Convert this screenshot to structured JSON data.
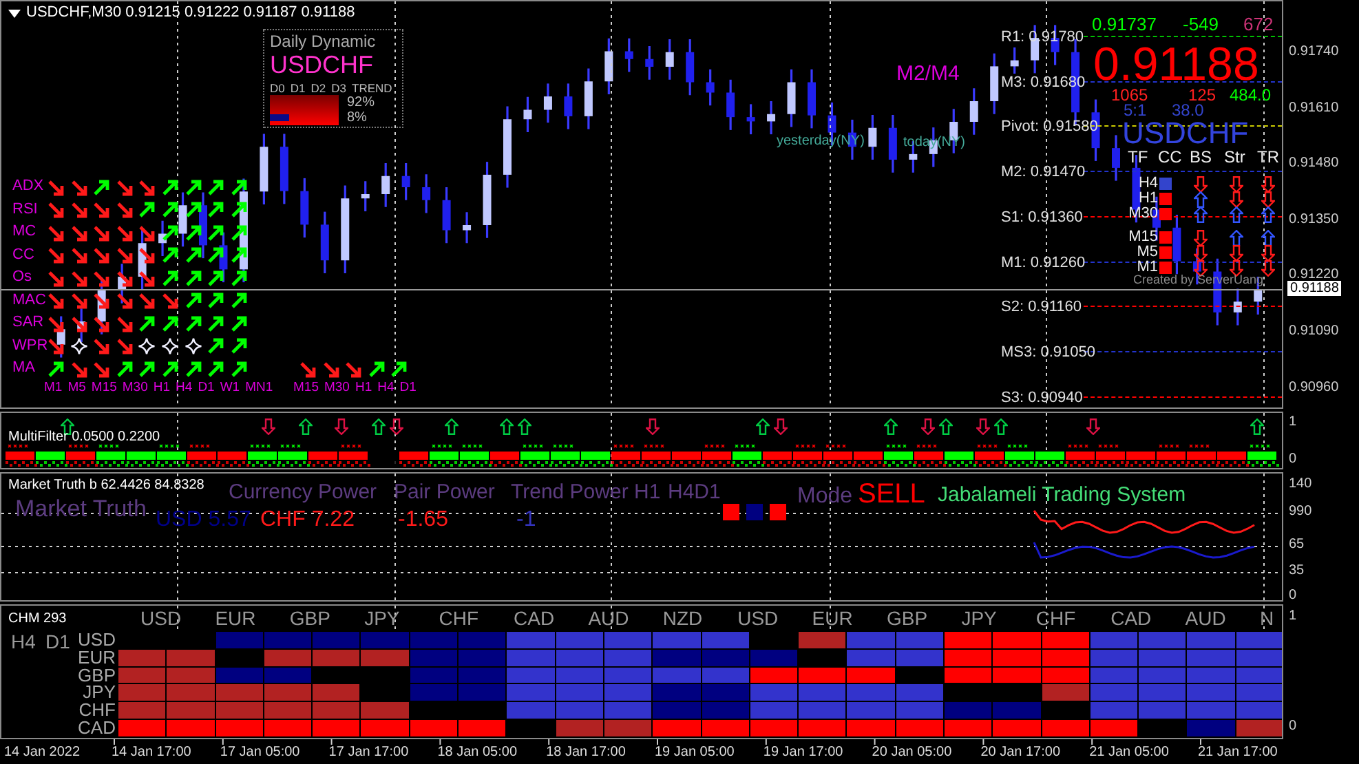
{
  "header": {
    "symbol_line": "USDCHF,M30  0.91215 0.91222 0.91187 0.91188"
  },
  "price_chart": {
    "chart_data": {
      "type": "candlestick",
      "categories": [
        null,
        null,
        null,
        null,
        null,
        null,
        null,
        null,
        null,
        null,
        null,
        null,
        null,
        null,
        null,
        null,
        null,
        null,
        null,
        null,
        null,
        null,
        null,
        null,
        null,
        null,
        null,
        null,
        null,
        null,
        null,
        null,
        null,
        null,
        null,
        null,
        null,
        null,
        null,
        null,
        null,
        null,
        null,
        null,
        null,
        null,
        null,
        null,
        null,
        null,
        null,
        null,
        null,
        null,
        null,
        null,
        null,
        null,
        null,
        null
      ],
      "ohlc": [
        [
          0.9106,
          0.91126,
          0.9103,
          0.91096
        ],
        [
          0.91096,
          0.91144,
          0.91066,
          0.91114
        ],
        [
          0.91114,
          0.91216,
          0.91084,
          0.91186
        ],
        [
          0.91186,
          0.91248,
          0.91156,
          0.91218
        ],
        [
          0.91218,
          0.91326,
          0.91188,
          0.91296
        ],
        [
          0.91296,
          0.91348,
          0.91266,
          0.91318
        ],
        [
          0.91318,
          0.91414,
          0.91288,
          0.91384
        ],
        [
          0.91384,
          0.91414,
          0.91261,
          0.91291
        ],
        [
          0.91291,
          0.91321,
          0.91205,
          0.91235
        ],
        [
          0.91235,
          0.91446,
          0.91205,
          0.91416
        ],
        [
          0.91416,
          0.9155,
          0.91386,
          0.9152
        ],
        [
          0.9152,
          0.9155,
          0.91387,
          0.91417
        ],
        [
          0.91417,
          0.91447,
          0.91309,
          0.91339
        ],
        [
          0.91339,
          0.91369,
          0.91226,
          0.91256
        ],
        [
          0.91256,
          0.9143,
          0.91226,
          0.914
        ],
        [
          0.914,
          0.9144,
          0.9137,
          0.9141
        ],
        [
          0.9141,
          0.91482,
          0.9138,
          0.91452
        ],
        [
          0.91452,
          0.91482,
          0.91396,
          0.91426
        ],
        [
          0.91426,
          0.91456,
          0.91366,
          0.91396
        ],
        [
          0.91396,
          0.91426,
          0.91296,
          0.91326
        ],
        [
          0.91326,
          0.91368,
          0.91296,
          0.91338
        ],
        [
          0.91338,
          0.91485,
          0.91308,
          0.91455
        ],
        [
          0.91455,
          0.91614,
          0.91425,
          0.91584
        ],
        [
          0.91584,
          0.91636,
          0.91554,
          0.91606
        ],
        [
          0.91606,
          0.91667,
          0.91576,
          0.91637
        ],
        [
          0.91637,
          0.91667,
          0.91561,
          0.91591
        ],
        [
          0.91591,
          0.91702,
          0.91561,
          0.91672
        ],
        [
          0.91672,
          0.91772,
          0.91642,
          0.91742
        ],
        [
          0.91742,
          0.91772,
          0.91694,
          0.91724
        ],
        [
          0.91724,
          0.91754,
          0.91676,
          0.91706
        ],
        [
          0.91706,
          0.9177,
          0.91676,
          0.9174
        ],
        [
          0.9174,
          0.9177,
          0.9164,
          0.9167
        ],
        [
          0.9167,
          0.917,
          0.91616,
          0.91646
        ],
        [
          0.91646,
          0.91676,
          0.91559,
          0.91589
        ],
        [
          0.91589,
          0.91619,
          0.91549,
          0.91579
        ],
        [
          0.91579,
          0.91626,
          0.91549,
          0.91596
        ],
        [
          0.91596,
          0.917,
          0.91566,
          0.9167
        ],
        [
          0.9167,
          0.917,
          0.91563,
          0.91593
        ],
        [
          0.91593,
          0.91623,
          0.91523,
          0.91553
        ],
        [
          0.91553,
          0.91583,
          0.9149,
          0.9152
        ],
        [
          0.9152,
          0.91594,
          0.9149,
          0.91564
        ],
        [
          0.91564,
          0.91594,
          0.9146,
          0.9149
        ],
        [
          0.9149,
          0.91533,
          0.9146,
          0.91503
        ],
        [
          0.91503,
          0.91565,
          0.91473,
          0.91535
        ],
        [
          0.91535,
          0.91608,
          0.91505,
          0.91578
        ],
        [
          0.91578,
          0.91656,
          0.91548,
          0.91626
        ],
        [
          0.91626,
          0.91737,
          0.91596,
          0.91707
        ],
        [
          0.91707,
          0.91751,
          0.9169,
          0.91721
        ],
        [
          0.91721,
          0.91803,
          0.91691,
          0.91773
        ],
        [
          0.91773,
          0.91803,
          0.9171,
          0.9174
        ],
        [
          0.9174,
          0.9177,
          0.9157,
          0.916
        ],
        [
          0.916,
          0.9163,
          0.91487,
          0.91517
        ],
        [
          0.91517,
          0.91547,
          0.91441,
          0.91471
        ],
        [
          0.91471,
          0.91501,
          0.91344,
          0.91374
        ],
        [
          0.91374,
          0.91404,
          0.91302,
          0.91332
        ],
        [
          0.91332,
          0.91362,
          0.91224,
          0.91254
        ],
        [
          0.91254,
          0.91284,
          0.912,
          0.9123
        ],
        [
          0.9123,
          0.9126,
          0.91105,
          0.91135
        ],
        [
          0.91135,
          0.9119,
          0.91105,
          0.9116
        ],
        [
          0.9116,
          0.91218,
          0.9113,
          0.91188
        ]
      ],
      "ylim": [
        0.90914,
        0.91858
      ],
      "yticks": [
        {
          "value": 0.9174,
          "label": "0.91740"
        },
        {
          "value": 0.9161,
          "label": "0.91610"
        },
        {
          "value": 0.9148,
          "label": "0.91480"
        },
        {
          "value": 0.9135,
          "label": "0.91350"
        },
        {
          "value": 0.9122,
          "label": "0.91220"
        },
        {
          "value": 0.9109,
          "label": "0.91090"
        },
        {
          "value": 0.9096,
          "label": "0.90960"
        }
      ]
    },
    "current_price": "0.91188"
  },
  "signal_matrix": {
    "rows": [
      {
        "label": "ADX",
        "cells": [
          {
            "kind": "down"
          },
          {
            "kind": "down"
          },
          {
            "kind": "up"
          },
          {
            "kind": "down"
          },
          {
            "kind": "down"
          },
          {
            "kind": "up"
          },
          {
            "kind": "up"
          },
          {
            "kind": "up"
          },
          {
            "kind": "up"
          }
        ]
      },
      {
        "label": "RSI",
        "cells": [
          {
            "kind": "down"
          },
          {
            "kind": "down"
          },
          {
            "kind": "down"
          },
          {
            "kind": "down"
          },
          {
            "kind": "up"
          },
          {
            "kind": "up"
          },
          {
            "kind": "up"
          },
          {
            "kind": "up"
          },
          {
            "kind": "up"
          }
        ]
      },
      {
        "label": "MC",
        "cells": [
          {
            "kind": "down"
          },
          {
            "kind": "down"
          },
          {
            "kind": "down"
          },
          {
            "kind": "down"
          },
          {
            "kind": "down"
          },
          {
            "kind": "up"
          },
          {
            "kind": "up"
          },
          {
            "kind": "up"
          },
          {
            "kind": "up"
          }
        ]
      },
      {
        "label": "CC",
        "cells": [
          {
            "kind": "down"
          },
          {
            "kind": "down"
          },
          {
            "kind": "down"
          },
          {
            "kind": "down"
          },
          {
            "kind": "down"
          },
          {
            "kind": "up"
          },
          {
            "kind": "up"
          },
          {
            "kind": "up"
          },
          {
            "kind": "up"
          }
        ]
      },
      {
        "label": "Os",
        "cells": [
          {
            "kind": "down"
          },
          {
            "kind": "down"
          },
          {
            "kind": "down"
          },
          {
            "kind": "down"
          },
          {
            "kind": "down"
          },
          {
            "kind": "up"
          },
          {
            "kind": "up"
          },
          {
            "kind": "up"
          },
          {
            "kind": "up"
          }
        ]
      },
      {
        "label": "MAC",
        "cells": [
          {
            "kind": "down"
          },
          {
            "kind": "down"
          },
          {
            "kind": "down"
          },
          {
            "kind": "down"
          },
          {
            "kind": "down"
          },
          {
            "kind": "down"
          },
          {
            "kind": "up"
          },
          {
            "kind": "up"
          },
          {
            "kind": "up"
          }
        ]
      },
      {
        "label": "SAR",
        "cells": [
          {
            "kind": "down"
          },
          {
            "kind": "down"
          },
          {
            "kind": "down"
          },
          {
            "kind": "down"
          },
          {
            "kind": "up"
          },
          {
            "kind": "up"
          },
          {
            "kind": "up"
          },
          {
            "kind": "up"
          },
          {
            "kind": "up"
          }
        ]
      },
      {
        "label": "WPR",
        "cells": [
          {
            "kind": "down"
          },
          {
            "kind": "star"
          },
          {
            "kind": "down"
          },
          {
            "kind": "down"
          },
          {
            "kind": "star"
          },
          {
            "kind": "star"
          },
          {
            "kind": "star"
          },
          {
            "kind": "up"
          },
          {
            "kind": "up"
          }
        ]
      },
      {
        "label": "MA",
        "cells": [
          {
            "kind": "up"
          },
          {
            "kind": "down"
          },
          {
            "kind": "down"
          },
          {
            "kind": "up"
          },
          {
            "kind": "up"
          },
          {
            "kind": "up"
          },
          {
            "kind": "up"
          },
          {
            "kind": "up"
          },
          {
            "kind": "up"
          }
        ]
      }
    ],
    "columns": [
      "M1",
      "M5",
      "M15",
      "M30",
      "H1",
      "H4",
      "D1",
      "W1",
      "MN1"
    ],
    "extra": {
      "columns": [
        "M15",
        "M30",
        "H1",
        "H4",
        "D1"
      ],
      "cells": [
        {
          "kind": "down"
        },
        {
          "kind": "down"
        },
        {
          "kind": "down"
        },
        {
          "kind": "up"
        },
        {
          "kind": "up"
        }
      ]
    }
  },
  "daily_dynamic": {
    "title": "Daily Dynamic",
    "symbol": "USDCHF",
    "columns": [
      "D0",
      "D1",
      "D2",
      "D3",
      "TREND"
    ],
    "percent_high": "92%",
    "percent_low": "8%"
  },
  "pivot": {
    "levels": [
      {
        "label": "R1: 0.91780",
        "color": "#00c000"
      },
      {
        "label": "M3: 0.91680",
        "color": "#2233cc"
      },
      {
        "label": "Pivot: 0.91580",
        "color": "#cccc00"
      },
      {
        "label": "M2: 0.91470",
        "color": "#2233cc"
      },
      {
        "label": "S1: 0.91360",
        "color": "#ff0000"
      },
      {
        "label": "M1: 0.91260",
        "color": "#2233cc"
      },
      {
        "label": "S2: 0.91160",
        "color": "#ff0000"
      },
      {
        "label": "MS3: 0.91050",
        "color": "#2233cc"
      },
      {
        "label": "S3: 0.90940",
        "color": "#ff0000"
      }
    ],
    "top_price": "0.91737",
    "top_pips": "-549",
    "top_range": "672",
    "big_price": "0.91188",
    "ratio_label": "M2/M4",
    "stats": [
      "1065",
      "125",
      "484.0"
    ],
    "stats2": [
      "5:1",
      "38.0"
    ],
    "yesterday": "yesterday(NY)",
    "today": "today(NY)",
    "symbol": "USDCHF",
    "headers": [
      "TF",
      "CC",
      "BS",
      "Str",
      "TR"
    ],
    "rows": [
      {
        "tf": "H4",
        "color": "#3344cc",
        "signals": [
          {
            "kind": "down"
          },
          {
            "kind": "down"
          },
          {
            "kind": "down"
          }
        ]
      },
      {
        "tf": "H1",
        "color": "#ff0000",
        "signals": [
          {
            "kind": "up"
          },
          {
            "kind": "down"
          },
          {
            "kind": "down"
          }
        ]
      },
      {
        "tf": "M30",
        "color": "#ff0000",
        "signals": [
          {
            "kind": "up"
          },
          {
            "kind": "up"
          },
          {
            "kind": "up"
          }
        ]
      },
      {
        "tf": "M15",
        "color": "#ff0000",
        "signals": [
          {
            "kind": "down"
          },
          {
            "kind": "up"
          },
          {
            "kind": "up"
          }
        ]
      },
      {
        "tf": "M5",
        "color": "#ff0000",
        "signals": [
          {
            "kind": "down"
          },
          {
            "kind": "down"
          },
          {
            "kind": "down"
          }
        ]
      },
      {
        "tf": "M1",
        "color": "#ff0000",
        "signals": [
          {
            "kind": "down"
          },
          {
            "kind": "down"
          },
          {
            "kind": "down"
          }
        ]
      }
    ],
    "credit": "Created by ServerUang"
  },
  "multifilter": {
    "title": "MultiFilter 0.0500 0.2200",
    "axis": [
      "1",
      "0"
    ],
    "signals": [
      {
        "kind": "none"
      },
      {
        "kind": "none"
      },
      {
        "kind": "none"
      },
      {
        "kind": "up"
      },
      {
        "kind": "none"
      },
      {
        "kind": "none"
      },
      {
        "kind": "none"
      },
      {
        "kind": "none"
      },
      {
        "kind": "none"
      },
      {
        "kind": "none"
      },
      {
        "kind": "none"
      },
      {
        "kind": "none"
      },
      {
        "kind": "none"
      },
      {
        "kind": "none"
      },
      {
        "kind": "down"
      },
      {
        "kind": "none"
      },
      {
        "kind": "up"
      },
      {
        "kind": "none"
      },
      {
        "kind": "down"
      },
      {
        "kind": "none"
      },
      {
        "kind": "up"
      },
      {
        "kind": "down"
      },
      {
        "kind": "none"
      },
      {
        "kind": "none"
      },
      {
        "kind": "up"
      },
      {
        "kind": "none"
      },
      {
        "kind": "none"
      },
      {
        "kind": "up"
      },
      {
        "kind": "up"
      },
      {
        "kind": "none"
      },
      {
        "kind": "none"
      },
      {
        "kind": "none"
      },
      {
        "kind": "none"
      },
      {
        "kind": "none"
      },
      {
        "kind": "none"
      },
      {
        "kind": "down"
      },
      {
        "kind": "none"
      },
      {
        "kind": "none"
      },
      {
        "kind": "none"
      },
      {
        "kind": "none"
      },
      {
        "kind": "none"
      },
      {
        "kind": "up"
      },
      {
        "kind": "down"
      },
      {
        "kind": "none"
      },
      {
        "kind": "none"
      },
      {
        "kind": "none"
      },
      {
        "kind": "none"
      },
      {
        "kind": "none"
      },
      {
        "kind": "up"
      },
      {
        "kind": "none"
      },
      {
        "kind": "down"
      },
      {
        "kind": "up"
      },
      {
        "kind": "none"
      },
      {
        "kind": "down"
      },
      {
        "kind": "up"
      },
      {
        "kind": "none"
      },
      {
        "kind": "none"
      },
      {
        "kind": "none"
      },
      {
        "kind": "none"
      },
      {
        "kind": "down"
      },
      {
        "kind": "none"
      },
      {
        "kind": "none"
      },
      {
        "kind": "none"
      },
      {
        "kind": "none"
      },
      {
        "kind": "none"
      },
      {
        "kind": "none"
      },
      {
        "kind": "none"
      },
      {
        "kind": "none"
      },
      {
        "kind": "up"
      },
      {
        "kind": "none"
      }
    ],
    "bars": [
      {
        "color": "#ff0000"
      },
      {
        "color": "#00ff00"
      },
      {
        "color": "#ff0000"
      },
      {
        "color": "#00ff00"
      },
      {
        "color": "#00ff00"
      },
      {
        "color": "#00ff00"
      },
      {
        "color": "#ff0000"
      },
      {
        "color": "#ff0000"
      },
      {
        "color": "#00ff00"
      },
      {
        "color": "#00ff00"
      },
      {
        "color": "#ff0000"
      },
      {
        "color": "#ff0000"
      },
      {
        "color": "#000000"
      },
      {
        "color": "#ff0000"
      },
      {
        "color": "#00ff00"
      },
      {
        "color": "#00ff00"
      },
      {
        "color": "#ff0000"
      },
      {
        "color": "#00ff00"
      },
      {
        "color": "#00ff00"
      },
      {
        "color": "#00ff00"
      },
      {
        "color": "#ff0000"
      },
      {
        "color": "#ff0000"
      },
      {
        "color": "#ff0000"
      },
      {
        "color": "#ff0000"
      },
      {
        "color": "#00ff00"
      },
      {
        "color": "#ff0000"
      },
      {
        "color": "#ff0000"
      },
      {
        "color": "#ff0000"
      },
      {
        "color": "#ff0000"
      },
      {
        "color": "#00ff00"
      },
      {
        "color": "#ff0000"
      },
      {
        "color": "#00ff00"
      },
      {
        "color": "#ff0000"
      },
      {
        "color": "#00ff00"
      },
      {
        "color": "#00ff00"
      },
      {
        "color": "#ff0000"
      },
      {
        "color": "#ff0000"
      },
      {
        "color": "#ff0000"
      },
      {
        "color": "#ff0000"
      },
      {
        "color": "#ff0000"
      },
      {
        "color": "#ff0000"
      },
      {
        "color": "#00ff00"
      }
    ]
  },
  "market_truth": {
    "header": "Market Truth b 62.4426 84.8328",
    "title": "Market Truth",
    "currency_power": "Currency Power",
    "pair_power": "Pair Power",
    "trend_power": "Trend Power H1",
    "trend_frames": "H4D1",
    "trend_boxes": [
      {
        "color": "#ff0000"
      },
      {
        "color": "#000080"
      },
      {
        "color": "#ff0000"
      }
    ],
    "mode_label": "Mode",
    "mode": "SELL",
    "system": "Jabalameli Trading System",
    "base": "USD 5.57",
    "quote": "CHF 7.22",
    "pair_value": "-1.65",
    "trend_value": "-1",
    "axis": [
      "140",
      "990",
      "65",
      "35",
      "0"
    ]
  },
  "chm": {
    "title": "CHM 293",
    "frames": [
      "H4",
      "D1"
    ],
    "axis": [
      "1",
      "0"
    ],
    "columns": [
      "USD",
      "EUR",
      "GBP",
      "JPY",
      "CHF",
      "CAD",
      "AUD",
      "NZD",
      "USD",
      "EUR",
      "GBP",
      "JPY",
      "CHF",
      "CAD",
      "AUD",
      "N"
    ],
    "rows": [
      {
        "label": "USD",
        "cells": [
          {
            "color": "#000000"
          },
          {
            "color": "#000000"
          },
          {
            "color": "#000080"
          },
          {
            "color": "#000080"
          },
          {
            "color": "#000080"
          },
          {
            "color": "#000080"
          },
          {
            "color": "#000080"
          },
          {
            "color": "#000080"
          },
          {
            "color": "#3333cc"
          },
          {
            "color": "#3333cc"
          },
          {
            "color": "#3333cc"
          },
          {
            "color": "#3333cc"
          },
          {
            "color": "#3333cc"
          },
          {
            "color": "#000000"
          },
          {
            "color": "#b22222"
          },
          {
            "color": "#3333cc"
          },
          {
            "color": "#3333cc"
          },
          {
            "color": "#ff0000"
          },
          {
            "color": "#ff0000"
          },
          {
            "color": "#ff0000"
          },
          {
            "color": "#3333cc"
          },
          {
            "color": "#3333cc"
          },
          {
            "color": "#3333cc"
          },
          {
            "color": "#3333cc"
          }
        ]
      },
      {
        "label": "EUR",
        "cells": [
          {
            "color": "#b22222"
          },
          {
            "color": "#b22222"
          },
          {
            "color": "#000000"
          },
          {
            "color": "#b22222"
          },
          {
            "color": "#b22222"
          },
          {
            "color": "#b22222"
          },
          {
            "color": "#000080"
          },
          {
            "color": "#000080"
          },
          {
            "color": "#3333cc"
          },
          {
            "color": "#3333cc"
          },
          {
            "color": "#3333cc"
          },
          {
            "color": "#000080"
          },
          {
            "color": "#000080"
          },
          {
            "color": "#000080"
          },
          {
            "color": "#000000"
          },
          {
            "color": "#3333cc"
          },
          {
            "color": "#3333cc"
          },
          {
            "color": "#ff0000"
          },
          {
            "color": "#ff0000"
          },
          {
            "color": "#ff0000"
          },
          {
            "color": "#3333cc"
          },
          {
            "color": "#3333cc"
          },
          {
            "color": "#3333cc"
          },
          {
            "color": "#3333cc"
          }
        ]
      },
      {
        "label": "GBP",
        "cells": [
          {
            "color": "#b22222"
          },
          {
            "color": "#b22222"
          },
          {
            "color": "#000080"
          },
          {
            "color": "#000080"
          },
          {
            "color": "#000000"
          },
          {
            "color": "#000000"
          },
          {
            "color": "#000080"
          },
          {
            "color": "#000080"
          },
          {
            "color": "#3333cc"
          },
          {
            "color": "#3333cc"
          },
          {
            "color": "#3333cc"
          },
          {
            "color": "#3333cc"
          },
          {
            "color": "#3333cc"
          },
          {
            "color": "#ff0000"
          },
          {
            "color": "#ff0000"
          },
          {
            "color": "#ff0000"
          },
          {
            "color": "#000000"
          },
          {
            "color": "#ff0000"
          },
          {
            "color": "#ff0000"
          },
          {
            "color": "#ff0000"
          },
          {
            "color": "#3333cc"
          },
          {
            "color": "#3333cc"
          },
          {
            "color": "#3333cc"
          },
          {
            "color": "#3333cc"
          }
        ]
      },
      {
        "label": "JPY",
        "cells": [
          {
            "color": "#b22222"
          },
          {
            "color": "#b22222"
          },
          {
            "color": "#b22222"
          },
          {
            "color": "#b22222"
          },
          {
            "color": "#b22222"
          },
          {
            "color": "#000000"
          },
          {
            "color": "#000080"
          },
          {
            "color": "#000080"
          },
          {
            "color": "#3333cc"
          },
          {
            "color": "#3333cc"
          },
          {
            "color": "#3333cc"
          },
          {
            "color": "#000080"
          },
          {
            "color": "#000080"
          },
          {
            "color": "#3333cc"
          },
          {
            "color": "#3333cc"
          },
          {
            "color": "#3333cc"
          },
          {
            "color": "#3333cc"
          },
          {
            "color": "#000000"
          },
          {
            "color": "#000000"
          },
          {
            "color": "#b22222"
          },
          {
            "color": "#3333cc"
          },
          {
            "color": "#3333cc"
          },
          {
            "color": "#3333cc"
          },
          {
            "color": "#3333cc"
          }
        ]
      },
      {
        "label": "CHF",
        "cells": [
          {
            "color": "#b22222"
          },
          {
            "color": "#b22222"
          },
          {
            "color": "#b22222"
          },
          {
            "color": "#b22222"
          },
          {
            "color": "#b22222"
          },
          {
            "color": "#b22222"
          },
          {
            "color": "#000000"
          },
          {
            "color": "#000000"
          },
          {
            "color": "#3333cc"
          },
          {
            "color": "#3333cc"
          },
          {
            "color": "#3333cc"
          },
          {
            "color": "#000080"
          },
          {
            "color": "#000080"
          },
          {
            "color": "#3333cc"
          },
          {
            "color": "#3333cc"
          },
          {
            "color": "#3333cc"
          },
          {
            "color": "#3333cc"
          },
          {
            "color": "#000080"
          },
          {
            "color": "#000080"
          },
          {
            "color": "#000000"
          },
          {
            "color": "#3333cc"
          },
          {
            "color": "#3333cc"
          },
          {
            "color": "#3333cc"
          },
          {
            "color": "#3333cc"
          }
        ]
      },
      {
        "label": "CAD",
        "cells": [
          {
            "color": "#ff0000"
          },
          {
            "color": "#ff0000"
          },
          {
            "color": "#ff0000"
          },
          {
            "color": "#ff0000"
          },
          {
            "color": "#ff0000"
          },
          {
            "color": "#ff0000"
          },
          {
            "color": "#ff0000"
          },
          {
            "color": "#ff0000"
          },
          {
            "color": "#000000"
          },
          {
            "color": "#b22222"
          },
          {
            "color": "#b22222"
          },
          {
            "color": "#ff0000"
          },
          {
            "color": "#ff0000"
          },
          {
            "color": "#ff0000"
          },
          {
            "color": "#ff0000"
          },
          {
            "color": "#ff0000"
          },
          {
            "color": "#ff0000"
          },
          {
            "color": "#ff0000"
          },
          {
            "color": "#ff0000"
          },
          {
            "color": "#ff0000"
          },
          {
            "color": "#ff0000"
          },
          {
            "color": "#000000"
          },
          {
            "color": "#000080"
          },
          {
            "color": "#b22222"
          }
        ]
      }
    ]
  },
  "time_axis": [
    "14 Jan 2022",
    "14 Jan 17:00",
    "17 Jan 05:00",
    "17 Jan 17:00",
    "18 Jan 05:00",
    "18 Jan 17:00",
    "19 Jan 05:00",
    "19 Jan 17:00",
    "20 Jan 05:00",
    "20 Jan 17:00",
    "21 Jan 05:00",
    "21 Jan 17:00"
  ]
}
